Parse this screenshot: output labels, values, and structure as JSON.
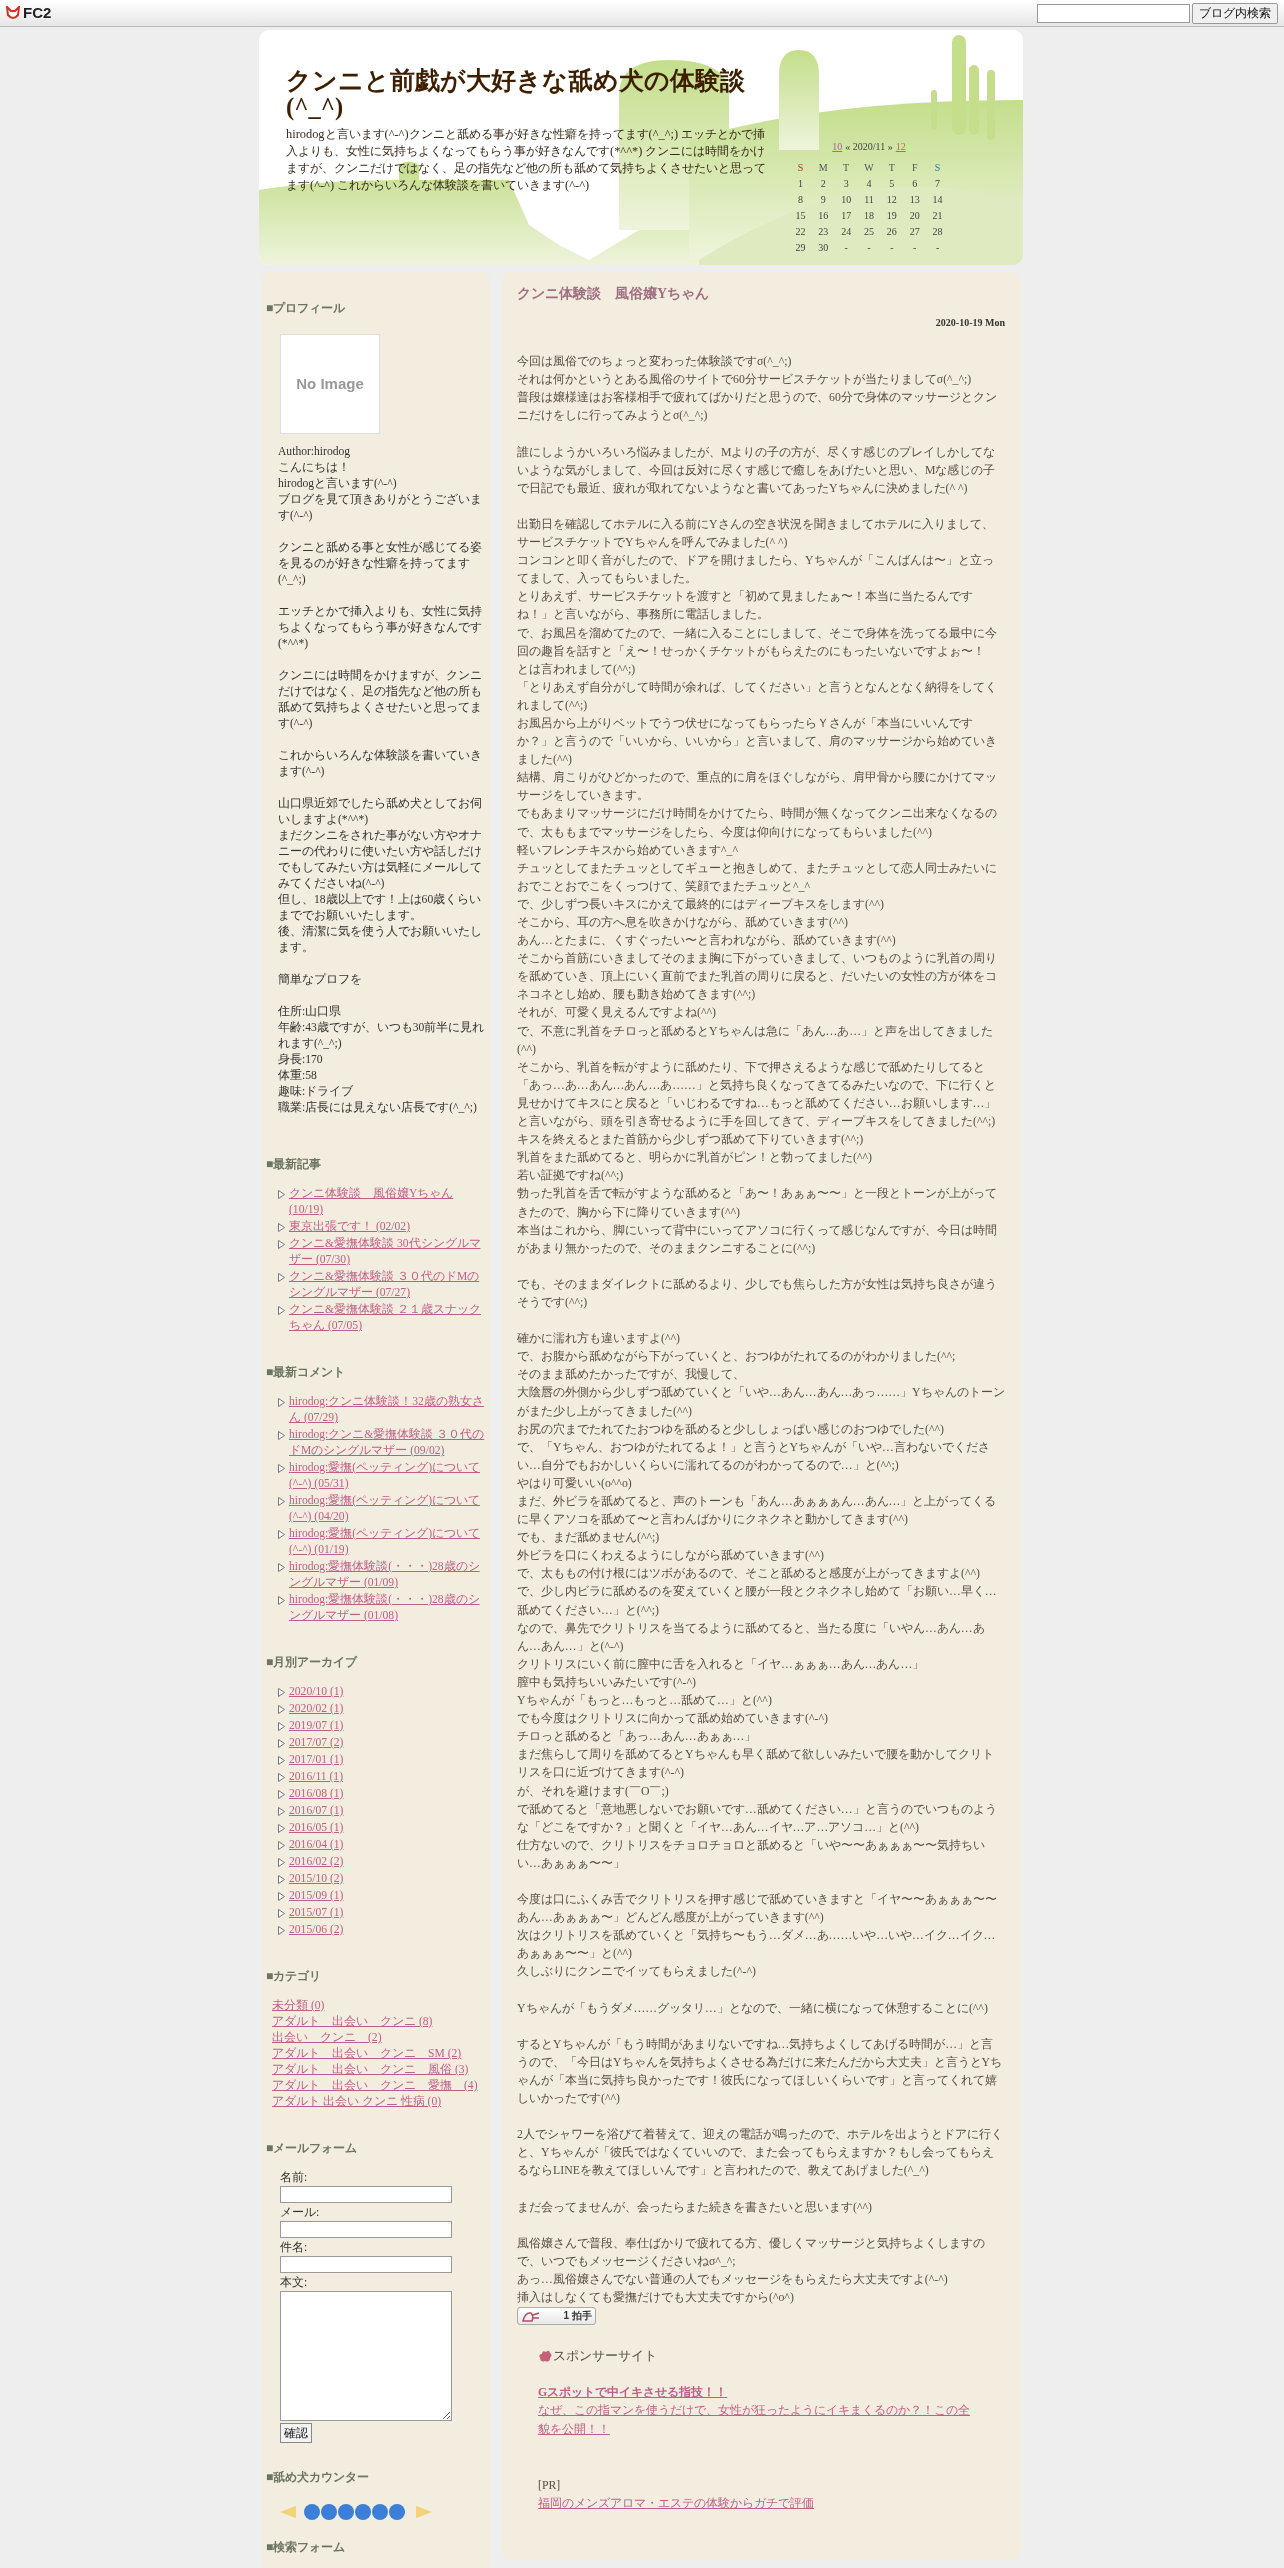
{
  "topbar": {
    "logo": "FC2",
    "search_button": "ブログ内検索"
  },
  "header": {
    "title": "クンニと前戯が大好きな舐め犬の体験談(^_^)",
    "description": "hirodogと言います(^-^)クンニと舐める事が好きな性癖を持ってます(^_^;) エッチとかで挿入よりも、女性に気持ちよくなってもらう事が好きなんです(*^^*) クンニには時間をかけますが、クンニだけではなく、足の指先など他の所も舐めて気持ちよくさせたいと思ってます(^-^) これからいろんな体験談を書いていきます(^-^)",
    "calendar": {
      "prev": "10",
      "title": "« 2020/11 »",
      "next": "12",
      "weekdays": [
        {
          "label": "S",
          "kind": "sun"
        },
        {
          "label": "M",
          "kind": "day"
        },
        {
          "label": "T",
          "kind": "day"
        },
        {
          "label": "W",
          "kind": "day"
        },
        {
          "label": "T",
          "kind": "day"
        },
        {
          "label": "F",
          "kind": "day"
        },
        {
          "label": "S",
          "kind": "sat"
        }
      ],
      "weeks": [
        [
          "1",
          "2",
          "3",
          "4",
          "5",
          "6",
          "7"
        ],
        [
          "8",
          "9",
          "10",
          "11",
          "12",
          "13",
          "14"
        ],
        [
          "15",
          "16",
          "17",
          "18",
          "19",
          "20",
          "21"
        ],
        [
          "22",
          "23",
          "24",
          "25",
          "26",
          "27",
          "28"
        ],
        [
          "29",
          "30",
          "-",
          "-",
          "-",
          "-",
          "-"
        ]
      ]
    }
  },
  "sidebar": {
    "profile": {
      "heading": "■プロフィール",
      "avatar": "No Image",
      "paragraphs": [
        [
          "Author:hirodog",
          "こんにちは！",
          "hirodogと言います(^-^)",
          "ブログを見て頂きありがとうございます(^-^)"
        ],
        [
          "クンニと舐める事と女性が感じてる姿を見るのが好きな性癖を持ってます(^_^;)"
        ],
        [
          "エッチとかで挿入よりも、女性に気持ちよくなってもらう事が好きなんです(*^^*)"
        ],
        [
          "クンニには時間をかけますが、クンニだけではなく、足の指先など他の所も舐めて気持ちよくさせたいと思ってます(^-^)"
        ],
        [
          "これからいろんな体験談を書いていきます(^-^)"
        ],
        [
          "山口県近郊でしたら舐め犬としてお伺いしますよ(*^^*)",
          "まだクンニをされた事がない方やオナニーの代わりに使いたい方や話しだけでもしてみたい方は気軽にメールしてみてくださいね(^-^)",
          "但し、18歳以上です！上は60歳くらいまででお願いいたします。",
          "後、清潔に気を使う人でお願いいたします。"
        ],
        [
          "簡単なプロフを"
        ],
        [
          "住所:山口県",
          "年齢:43歳ですが、いつも30前半に見れれます(^_^;)",
          "身長:170",
          "体重:58",
          "趣味:ドライブ",
          "職業:店長には見えない店長です(^_^;)"
        ]
      ]
    },
    "recent_posts": {
      "heading": "■最新記事",
      "items": [
        "クンニ体験談　風俗嬢Yちゃん (10/19)",
        "東京出張です！ (02/02)",
        "クンニ&愛撫体験談 30代シングルマザー (07/30)",
        "クンニ&愛撫体験談 ３０代のドMのシングルマザー (07/27)",
        "クンニ&愛撫体験談 ２１歳スナックちゃん (07/05)"
      ]
    },
    "recent_comments": {
      "heading": "■最新コメント",
      "items": [
        "hirodog:クンニ体験談！32歳の熟女さん (07/29)",
        "hirodog:クンニ&愛撫体験談 ３０代のドMのシングルマザー (09/02)",
        "hirodog:愛撫(ペッティング)について(^-^) (05/31)",
        "hirodog:愛撫(ペッティング)について(^-^) (04/20)",
        "hirodog:愛撫(ペッティング)について(^-^) (01/19)",
        "hirodog:愛撫体験談(・・・)28歳のシングルマザー (01/09)",
        "hirodog:愛撫体験談(・・・)28歳のシングルマザー (01/08)"
      ]
    },
    "archives": {
      "heading": "■月別アーカイブ",
      "items": [
        "2020/10 (1)",
        "2020/02 (1)",
        "2019/07 (1)",
        "2017/07 (2)",
        "2017/01 (1)",
        "2016/11 (1)",
        "2016/08 (1)",
        "2016/07 (1)",
        "2016/05 (1)",
        "2016/04 (1)",
        "2016/02 (2)",
        "2015/10 (2)",
        "2015/09 (1)",
        "2015/07 (1)",
        "2015/06 (2)"
      ]
    },
    "categories": {
      "heading": "■カテゴリ",
      "items": [
        "未分類 (0)",
        "アダルト　出会い　クンニ (8)",
        "出会い　クンニ　(2)",
        "アダルト　出会い　クンニ　SM (2)",
        "アダルト　出会い　クンニ　風俗 (3)",
        "アダルト　出会い　クンニ　愛撫　(4)",
        "アダルト 出会い クンニ 性病 (0)"
      ]
    },
    "mail_form": {
      "heading": "■メールフォーム",
      "fields": [
        {
          "label": "名前:",
          "kind": "input"
        },
        {
          "label": "メール:",
          "kind": "input"
        },
        {
          "label": "件名:",
          "kind": "input"
        },
        {
          "label": "本文:",
          "kind": "textarea"
        }
      ],
      "button": "確認"
    },
    "counter": {
      "heading": "■舐め犬カウンター"
    },
    "search": {
      "heading": "■検索フォーム"
    }
  },
  "article": {
    "title": "クンニ体験談　風俗嬢Yちゃん",
    "date": "2020-10-19 Mon",
    "paragraphs": [
      [
        "今回は風俗でのちょっと変わった体験談ですσ(^_^;)",
        "それは何かというとある風俗のサイトで60分サービスチケットが当たりましてσ(^_^;)",
        "普段は嬢様達はお客様相手で疲れてばかりだと思うので、60分で身体のマッサージとクンニだけをしに行ってみようとσ(^_^;)"
      ],
      [
        "誰にしようかいろいろ悩みましたが、Mよりの子の方が、尽くす感じのプレイしかしてないような気がしまして、今回は反対に尽くす感じで癒しをあげたいと思い、Mな感じの子で日記でも最近、疲れが取れてないようなと書いてあったYちゃんに決めました(^ ^)"
      ],
      [
        "出勤日を確認してホテルに入る前にYさんの空き状況を聞きましてホテルに入りまして、サービスチケットでYちゃんを呼んでみました(^ ^)",
        "コンコンと叩く音がしたので、ドアを開けましたら、Yちゃんが「こんばんは〜」と立ってまして、入ってもらいました。",
        "とりあえず、サービスチケットを渡すと「初めて見ましたぁ〜！本当に当たるんですね！」と言いながら、事務所に電話しました。",
        "で、お風呂を溜めてたので、一緒に入ることにしまして、そこで身体を洗ってる最中に今回の趣旨を話すと「え〜！せっかくチケットがもらえたのにもったいないですよぉ〜！",
        "とは言われまして(^^;)",
        "「とりあえず自分がして時間が余れば、してください」と言うとなんとなく納得をしてくれまして(^^;)",
        "お風呂から上がりベットでうつ伏せになってもらったらＹさんが「本当にいいんですか？」と言うので「いいから、いいから」と言いまして、肩のマッサージから始めていきました(^^)",
        "結構、肩こりがひどかったので、重点的に肩をほぐしながら、肩甲骨から腰にかけてマッサージをしていきます。",
        "でもあまりマッサージにだけ時間をかけてたら、時間が無くなってクンニ出来なくなるので、太ももまでマッサージをしたら、今度は仰向けになってもらいました(^^)",
        "軽いフレンチキスから始めていきます^_^",
        "チュッとしてまたチュッとしてギューと抱きしめて、またチュッとして恋人同士みたいにおでことおでこをくっつけて、笑顔でまたチュッと^_^",
        "で、少しずつ長いキスにかえて最終的にはディープキスをします(^^)",
        "そこから、耳の方へ息を吹きかけながら、舐めていきます(^^)",
        "あん…とたまに、くすぐったい〜と言われながら、舐めていきます(^^)",
        "そこから首筋にいきましてそのまま胸に下がっていきまして、いつものように乳首の周りを舐めていき、頂上にいく直前でまた乳首の周りに戻ると、だいたいの女性の方が体をコネコネとし始め、腰も動き始めてきます(^^;)",
        "それが、可愛く見えるんですよね(^^)",
        "で、不意に乳首をチロっと舐めるとYちゃんは急に「あん…あ…」と声を出してきました(^^)",
        "そこから、乳首を転がすように舐めたり、下で押さえるような感じで舐めたりしてると「あっ…あ…あん…あん…あ……」と気持ち良くなってきてるみたいなので、下に行くと見せかけてキスにと戻ると「いじわるですね…もっと舐めてください…お願いします…」と言いながら、頭を引き寄せるように手を回してきて、ディープキスをしてきました(^^;)",
        "キスを終えるとまた首筋から少しずつ舐めて下りていきます(^^;)",
        "乳首をまた舐めてると、明らかに乳首がピン！と勃ってました(^^)",
        "若い証拠ですね(^^;)",
        "勃った乳首を舌で転がすような舐めると「あ〜！あぁぁ〜〜」と一段とトーンが上がってきたので、胸から下に降りていきます(^^)",
        "本当はこれから、脚にいって背中にいってアソコに行くって感じなんですが、今日は時間があまり無かったので、そのままクンニすることに(^^;)"
      ],
      [
        "でも、そのままダイレクトに舐めるより、少しでも焦らした方が女性は気持ち良さが違うそうです(^^;)"
      ],
      [
        "確かに濡れ方も違いますよ(^^)",
        "で、お腹から舐めながら下がっていくと、おつゆがたれてるのがわかりました(^^;",
        "そのまま舐めたかったですが、我慢して、",
        "大陰唇の外側から少しずつ舐めていくと「いや…あん…あん…あっ……」Yちゃんのトーンがまた少し上がってきました(^^)",
        "お尻の穴までたれてたおつゆを舐めると少ししょっぱい感じのおつゆでした(^^)",
        "で、「Yちゃん、おつゆがたれてるよ！」と言うとYちゃんが「いや…言わないでください…自分でもおかしいくらいに濡れてるのがわかってるので…」と(^^;)",
        "やはり可愛いい(o^^o)",
        "まだ、外ビラを舐めてると、声のトーンも「あん…あぁぁぁん…あん…」と上がってくるに早くアソコを舐めて〜と言わんばかりにクネクネと動かしてきます(^^)",
        "でも、まだ舐めません(^^;)",
        "外ビラを口にくわえるようにしながら舐めていきます(^^)",
        "で、太ももの付け根にはツボがあるので、そこと舐めると感度が上がってきますよ(^^)",
        "で、少し内ビラに舐めるのを変えていくと腰が一段とクネクネし始めて「お願い…早く…舐めてください…」と(^^;)",
        "なので、鼻先でクリトリスを当てるように舐めてると、当たる度に「いやん…あん…あん…あん…」と(^-^)",
        "クリトリスにいく前に膣中に舌を入れると「イヤ…ぁぁぁ…あん…あん…」",
        "膣中も気持ちいいみたいです(^-^)",
        "Yちゃんが「もっと…もっと…舐めて…」と(^^)",
        "でも今度はクリトリスに向かって舐め始めていきます(^-^)",
        "チロっと舐めると「あっ…あん…あぁぁ…」",
        "まだ焦らして周りを舐めてるとYちゃんも早く舐めて欲しいみたいで腰を動かしてクリトリスを口に近づけてきます(^-^)",
        "が、それを避けます(￣O￣;)",
        "で舐めてると「意地悪しないでお願いです…舐めてください…」と言うのでいつものような「どこをですか？」と聞くと「イヤ…あん…イヤ…ア…アソコ…」と(^^)",
        "仕方ないので、クリトリスをチョロチョロと舐めると「いや〜〜あぁぁぁ〜〜気持ちいい…あぁぁぁ〜〜」"
      ],
      [
        "今度は口にふくみ舌でクリトリスを押す感じで舐めていきますと「イヤ〜〜あぁぁぁ〜〜あん…あぁぁぁ〜」どんどん感度が上がっていきます(^^)",
        "次はクリトリスを舐めていくと「気持ち〜もう…ダメ…あ……いや…いや…イク…イク…あぁぁぁ〜〜」と(^^)",
        "久しぶりにクンニでイッてもらえました(^-^)"
      ],
      [
        "Yちゃんが「もうダメ……グッタリ…」となので、一緒に横になって休憩することに(^^)"
      ],
      [
        "するとYちゃんが「もう時間があまりないですね…気持ちよくしてあげる時間が…」と言うので、「今日はYちゃんを気持ちよくさせる為だけに来たんだから大丈夫」と言うとYちゃんが「本当に気持ち良かったです！彼氏になってほしいくらいです」と言ってくれて嬉しいかったです(^^)"
      ],
      [
        "2人でシャワーを浴びて着替えて、迎えの電話が鳴ったので、ホテルを出ようとドアに行くと、Yちゃんが「彼氏ではなくていいので、また会ってもらえますか？もし会ってもらえるならLINEを教えてほしいんです」と言われたので、教えてあげました(^_^)"
      ],
      [
        "まだ会ってませんが、会ったらまた続きを書きたいと思います(^^)"
      ],
      [
        "風俗嬢さんで普段、奉仕ばかりで疲れてる方、優しくマッサージと気持ちよくしますので、いつでもメッセージくださいねσ^_^;",
        "あっ…風俗嬢さんでない普通の人でもメッセージをもらえたら大丈夫ですよ(^-^)",
        "挿入はしなくても愛撫だけでも大丈夫ですから(^o^)"
      ]
    ],
    "clap": {
      "count": "1",
      "label": "拍手"
    },
    "sponsor": {
      "heading": "スポンサーサイト",
      "link_title": "Gスポットで中イキさせる指技！！",
      "link_text": "なぜ、この指マンを使うだけで、女性が狂ったようにイキまくるのか？！この全貌を公開！！"
    },
    "pr": {
      "label": "[PR]",
      "link": "福岡のメンズアロマ・エステの体験からガチで評価"
    }
  }
}
